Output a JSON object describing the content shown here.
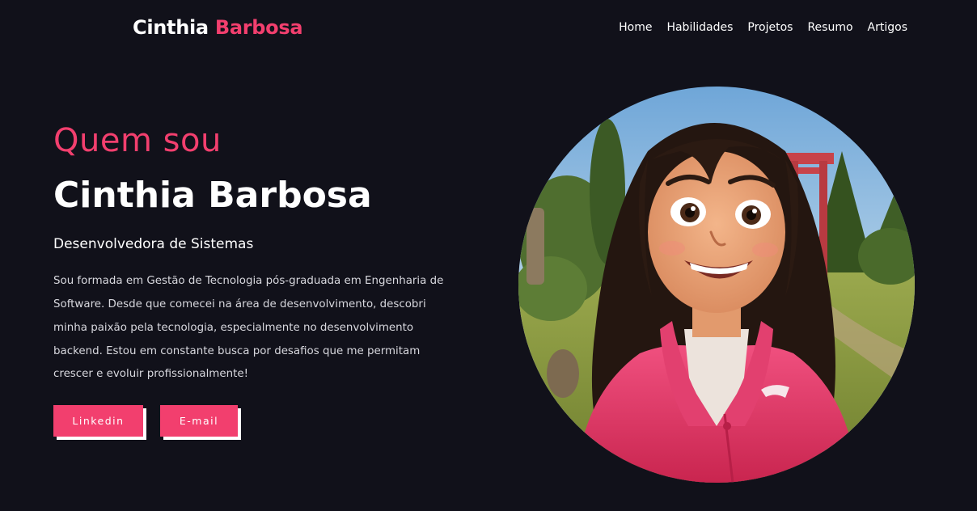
{
  "header": {
    "logo_first": "Cinthia",
    "logo_second": "Barbosa",
    "nav": [
      {
        "label": "Home"
      },
      {
        "label": "Habilidades"
      },
      {
        "label": "Projetos"
      },
      {
        "label": "Resumo"
      },
      {
        "label": "Artigos"
      }
    ]
  },
  "hero": {
    "greeting": "Quem sou",
    "name": "Cinthia Barbosa",
    "role": "Desenvolvedora de Sistemas",
    "bio": "Sou formada em Gestão de Tecnologia pós-graduada em Engenharia de Software. Desde que comecei na área de desenvolvimento, descobri minha paixão pela tecnologia, especialmente no desenvolvimento backend. Estou em constante busca por desafios que me permitam crescer e evoluir profissionalmente!",
    "buttons": {
      "linkedin": "Linkedin",
      "email": "E-mail"
    }
  },
  "colors": {
    "background": "#11111a",
    "accent": "#f23f6e",
    "text": "#ffffff"
  }
}
